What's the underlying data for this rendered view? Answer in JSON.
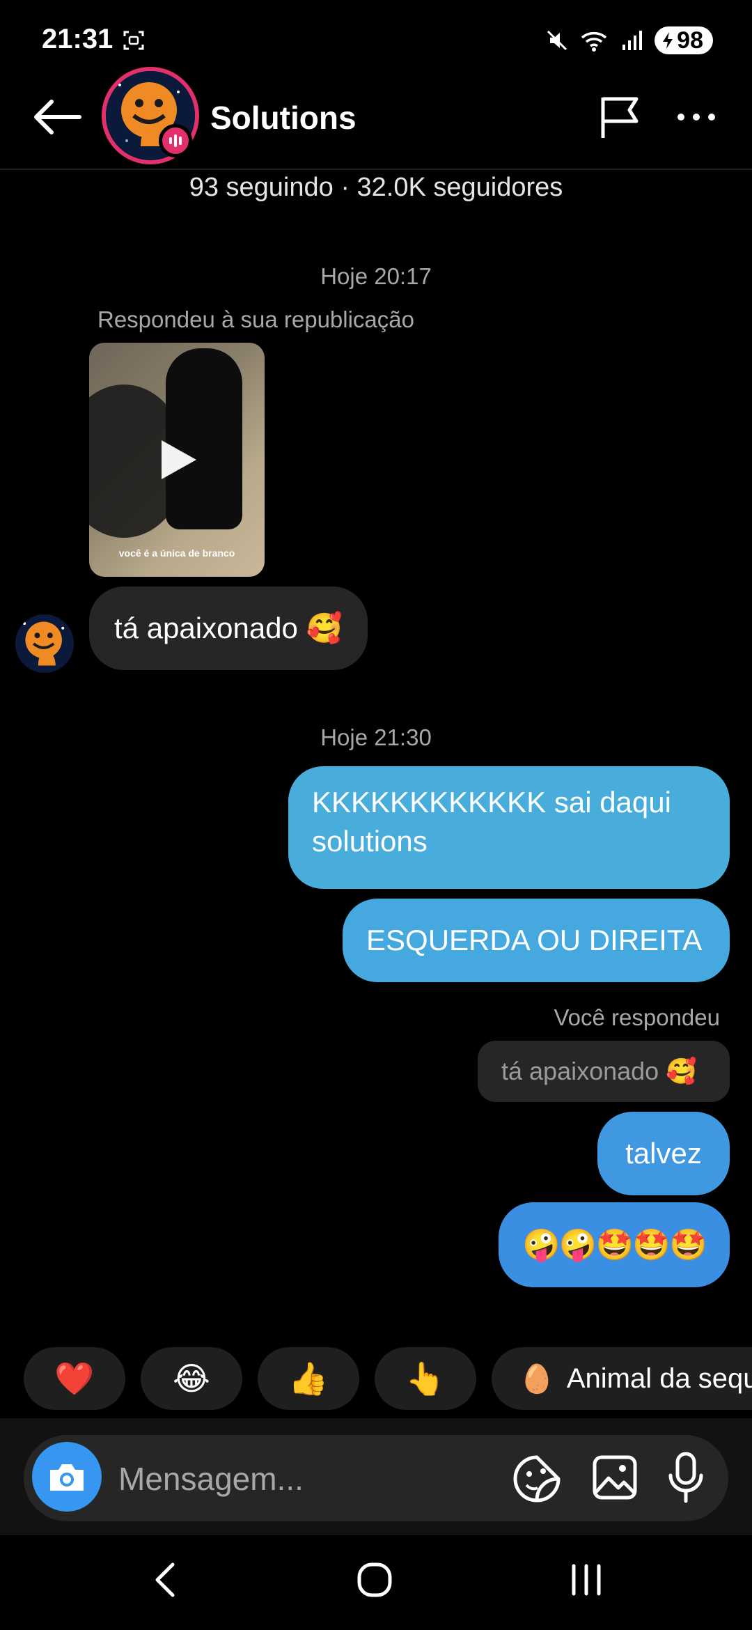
{
  "status_bar": {
    "time": "21:31",
    "battery": "98"
  },
  "header": {
    "contact_name": "Solutions",
    "follow_stats": "93 seguindo · 32.0K seguidores"
  },
  "conversation": {
    "timestamp_1": "Hoje 20:17",
    "reply_caption": "Respondeu à sua republicação",
    "video_caption": "você é a única de branco",
    "incoming_1": "tá apaixonado 🥰",
    "timestamp_2": "Hoje 21:30",
    "outgoing_1": "KKKKKKKKKKKK sai daqui solutions",
    "outgoing_2": "ESQUERDA OU DIREITA",
    "you_replied": "Você respondeu",
    "quoted_reply": "tá apaixonado 🥰",
    "outgoing_3": "talvez",
    "outgoing_4": "🤪🤪🤩🤩🤩"
  },
  "quick_replies": {
    "heart": "❤️",
    "laugh": "😂",
    "thumbs_up": "👍",
    "point": "👆",
    "animal_emoji": "🥚",
    "animal_label": "Animal da sequ"
  },
  "composer": {
    "placeholder": "Mensagem..."
  },
  "colors": {
    "outgoing_bubble": "#3fa4dc",
    "incoming_bubble": "#262626",
    "story_ring": "#e1306c",
    "camera_button": "#3797f0"
  }
}
